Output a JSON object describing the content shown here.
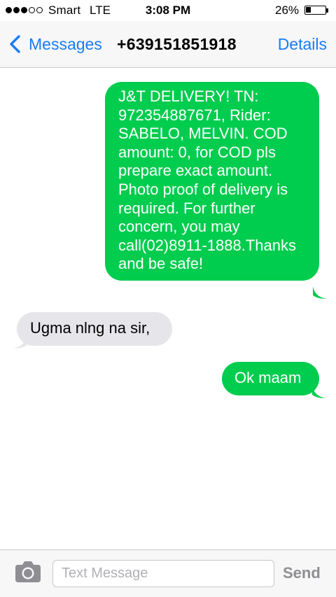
{
  "status_bar": {
    "signal_bars_filled": 3,
    "signal_bars_total": 5,
    "carrier": "Smart",
    "network": "LTE",
    "time": "3:08 PM",
    "battery_percent": "26%",
    "battery_level": 0.26
  },
  "nav": {
    "back_label": "Messages",
    "title": "+639151851918",
    "details_label": "Details"
  },
  "messages": [
    {
      "direction": "outgoing",
      "text": "J&T DELIVERY! TN: 972354887671, Rider: SABELO, MELVIN. COD amount: 0, for COD pls prepare exact amount. Photo proof of delivery is required. For further concern, you may call(02)8911-1888.Thanks and be safe!"
    },
    {
      "direction": "incoming",
      "text": "Ugma nlng na sir,"
    },
    {
      "direction": "outgoing",
      "text": "Ok maam"
    }
  ],
  "input_bar": {
    "camera_icon": "camera-icon",
    "placeholder": "Text Message",
    "value": "",
    "send_label": "Send"
  },
  "colors": {
    "accent": "#1a7cf5",
    "outgoing_bubble": "#00cc4e",
    "incoming_bubble": "#e5e5ea"
  }
}
